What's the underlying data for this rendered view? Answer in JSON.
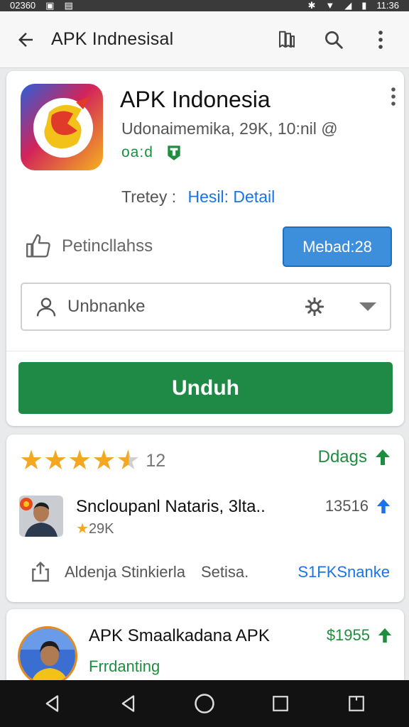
{
  "status_bar": {
    "left_text": "02360",
    "time": "11:36"
  },
  "app_bar": {
    "title": "APK Indnesisal"
  },
  "app": {
    "name": "APK Indonesia",
    "meta": "Udonaimemika, 29K, 10:nil @",
    "badge_text": "oa:d",
    "category_label": "Tretey :",
    "category_link": "Hesil: Detail",
    "like_label": "Petincllahss",
    "version_button": "Mebad:28",
    "user_field_label": "Unbnanke",
    "install_button": "Unduh"
  },
  "reviews": {
    "stars": 4.5,
    "rating_count": "12",
    "status_label": "Ddags",
    "review": {
      "name": "Sncloupanl Nataris, 3lta..",
      "rating_text": "29K",
      "count": "13516"
    },
    "share_row": {
      "text1": "Aldenja Stinkierla",
      "text2": "Setisa.",
      "link": "S1FKSnanke"
    }
  },
  "bottom_item": {
    "title": "APK Smaalkadana APK",
    "subtitle": "Frrdanting",
    "price": "$1955"
  },
  "colors": {
    "accent_blue": "#1a73e8",
    "install_green": "#1e8a45",
    "version_blue": "#3d8fdc",
    "star": "#f5a623"
  },
  "icons": [
    "back-arrow-icon",
    "bookmark-icon",
    "search-icon",
    "more-vert-icon",
    "thumbs-up-icon",
    "user-icon",
    "gear-icon",
    "chevron-down-icon",
    "arrow-up-icon",
    "share-icon",
    "nav-back-icon",
    "nav-home-icon",
    "nav-recents-icon"
  ]
}
